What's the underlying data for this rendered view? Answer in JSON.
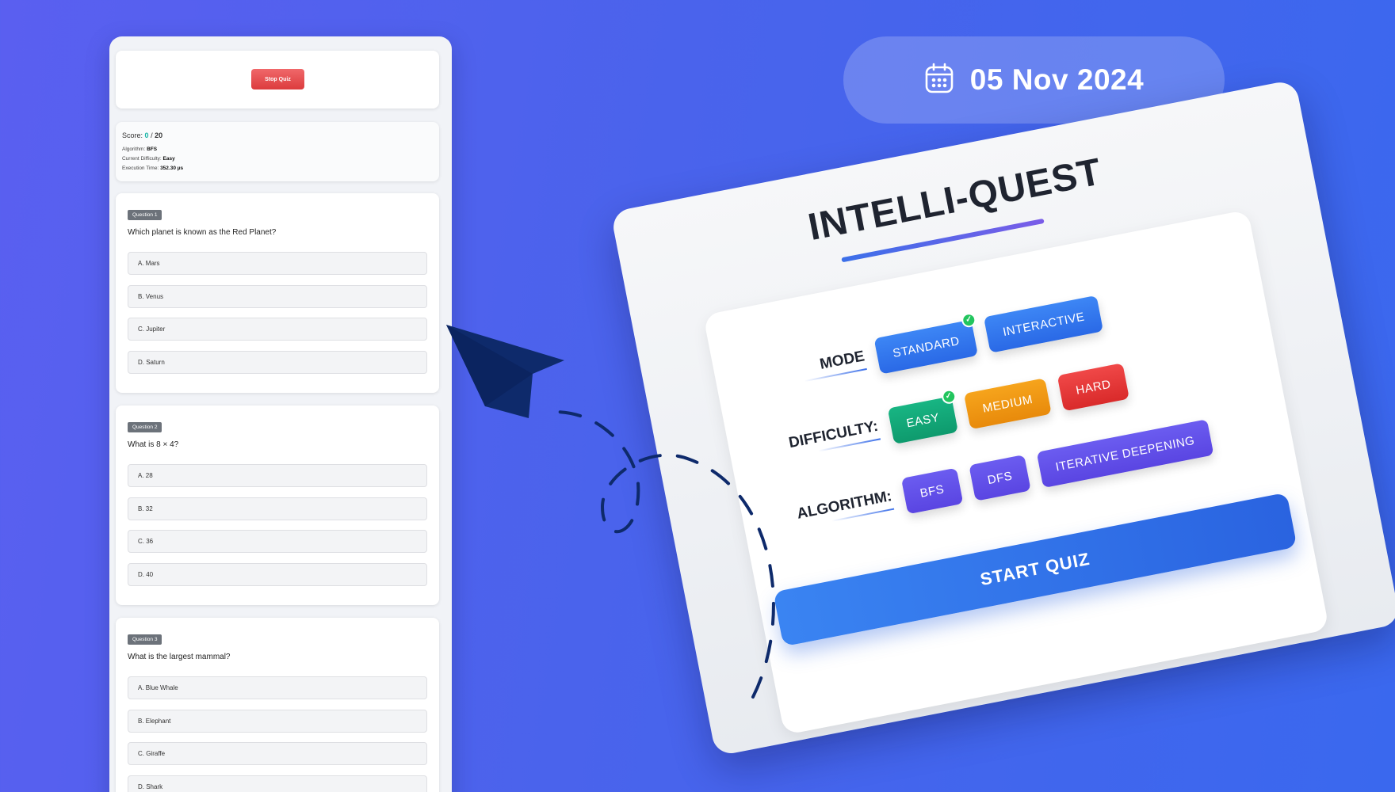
{
  "quiz_panel": {
    "stop_button": "Stop Quiz",
    "score": {
      "label": "Score:",
      "value": "0",
      "sep": "/",
      "total": "20",
      "algorithm_label": "Algorithm:",
      "algorithm": "BFS",
      "difficulty_label": "Current Difficulty:",
      "difficulty": "Easy",
      "time_label": "Execution Time:",
      "time": "352.30 µs"
    },
    "questions": [
      {
        "badge": "Question 1",
        "text": "Which planet is known as the Red Planet?",
        "options": [
          "A. Mars",
          "B. Venus",
          "C. Jupiter",
          "D. Saturn"
        ]
      },
      {
        "badge": "Question 2",
        "text": "What is 8 × 4?",
        "options": [
          "A. 28",
          "B. 32",
          "C. 36",
          "D. 40"
        ]
      },
      {
        "badge": "Question 3",
        "text": "What is the largest mammal?",
        "options": [
          "A. Blue Whale",
          "B. Elephant",
          "C. Giraffe",
          "D. Shark"
        ]
      }
    ]
  },
  "date_pill": {
    "icon": "calendar-icon",
    "text": "05 Nov 2024"
  },
  "config": {
    "title": "INTELLI-QUEST",
    "mode": {
      "label": "MODE",
      "options": [
        "STANDARD",
        "INTERACTIVE"
      ],
      "selected": "STANDARD"
    },
    "difficulty": {
      "label": "DIFFICULTY:",
      "options": [
        "EASY",
        "MEDIUM",
        "HARD"
      ],
      "selected": "EASY"
    },
    "algorithm": {
      "label": "ALGORITHM:",
      "options": [
        "BFS",
        "DFS",
        "ITERATIVE DEEPENING"
      ]
    },
    "start_button": "START QUIZ"
  },
  "colors": {
    "background_start": "#5a5ff0",
    "background_end": "#3a68ee",
    "accent_blue": "#2a69e6",
    "easy_green": "#0e9a6d",
    "medium_orange": "#e88a0b",
    "hard_red": "#d92a2a",
    "algo_purple": "#5a45e2",
    "score_teal": "#17b4a6",
    "arrow_navy": "#0e2a6b"
  }
}
